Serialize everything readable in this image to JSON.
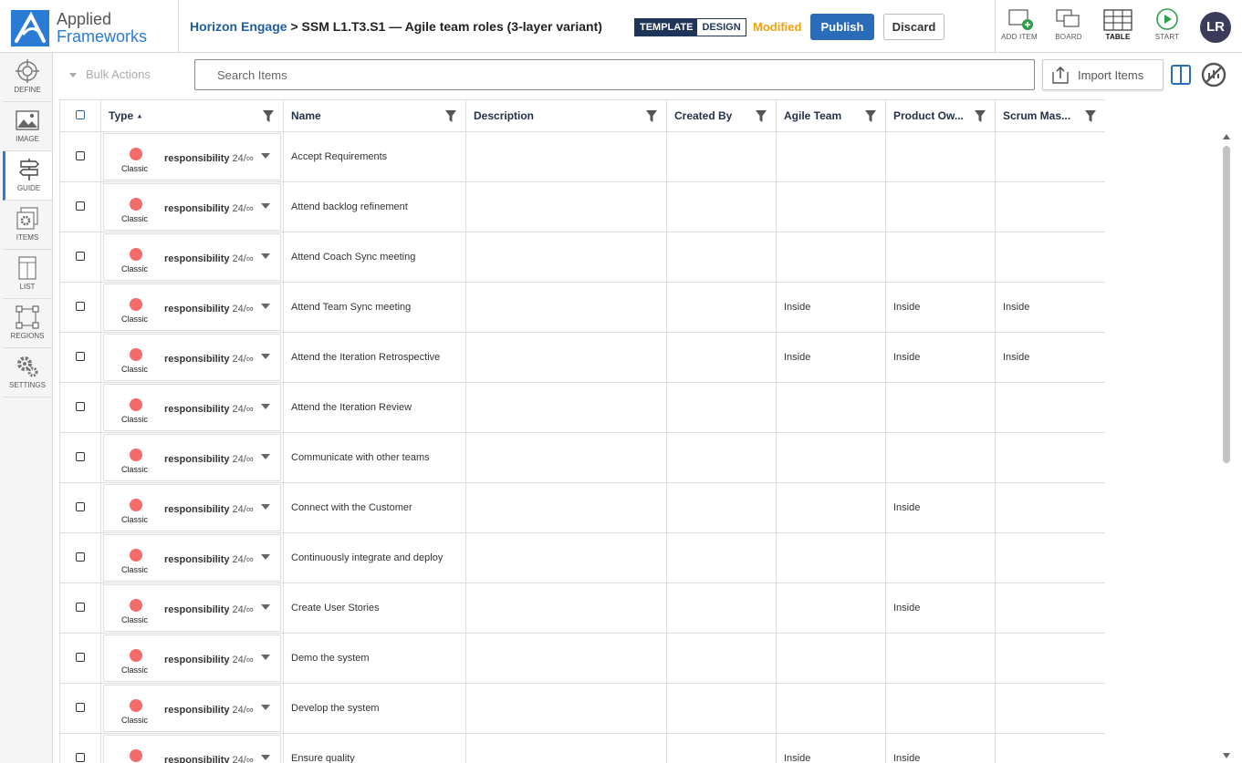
{
  "header": {
    "logo": {
      "line1": "Applied",
      "line2": "Frameworks"
    },
    "breadcrumb": {
      "project": "Horizon Engage",
      "separator": " > ",
      "page": "SSM L1.T3.S1 — Agile team roles (3-layer variant)"
    },
    "mode": {
      "template": "TEMPLATE",
      "design": "DESIGN"
    },
    "status": "Modified",
    "publish_label": "Publish",
    "discard_label": "Discard",
    "tools": {
      "add_item": "ADD ITEM",
      "board": "BOARD",
      "table": "TABLE",
      "start": "START"
    },
    "avatar_initials": "LR"
  },
  "sidebar": {
    "items": [
      {
        "label": "DEFINE",
        "icon": "target-icon"
      },
      {
        "label": "IMAGE",
        "icon": "image-icon"
      },
      {
        "label": "GUIDE",
        "icon": "signpost-icon"
      },
      {
        "label": "ITEMS",
        "icon": "stacked-gear-icon"
      },
      {
        "label": "LIST",
        "icon": "list-icon"
      },
      {
        "label": "REGIONS",
        "icon": "regions-icon"
      },
      {
        "label": "SETTINGS",
        "icon": "settings-icon"
      }
    ],
    "active": "GUIDE"
  },
  "toolbar": {
    "bulk_actions": "Bulk Actions",
    "search_placeholder": "Search Items",
    "import_label": "Import Items"
  },
  "table": {
    "headers": {
      "type": "Type",
      "name": "Name",
      "description": "Description",
      "created_by": "Created By",
      "agile_team": "Agile Team",
      "product_owner": "Product Ow...",
      "scrum_master": "Scrum Mas..."
    },
    "sort_indicator": "▲",
    "type_cell": {
      "style": "Classic",
      "name": "responsibility",
      "count": "24/∞",
      "dot_color": "#f36b6b"
    },
    "rows": [
      {
        "name": "Accept Requirements",
        "description": "",
        "created_by": "",
        "agile_team": "",
        "product_owner": "",
        "scrum_master": ""
      },
      {
        "name": "Attend backlog refinement",
        "description": "",
        "created_by": "",
        "agile_team": "",
        "product_owner": "",
        "scrum_master": ""
      },
      {
        "name": "Attend Coach Sync meeting",
        "description": "",
        "created_by": "",
        "agile_team": "",
        "product_owner": "",
        "scrum_master": ""
      },
      {
        "name": "Attend Team Sync meeting",
        "description": "",
        "created_by": "",
        "agile_team": "Inside",
        "product_owner": "Inside",
        "scrum_master": "Inside"
      },
      {
        "name": "Attend the Iteration Retrospective",
        "description": "",
        "created_by": "",
        "agile_team": "Inside",
        "product_owner": "Inside",
        "scrum_master": "Inside"
      },
      {
        "name": "Attend the Iteration Review",
        "description": "",
        "created_by": "",
        "agile_team": "",
        "product_owner": "",
        "scrum_master": ""
      },
      {
        "name": "Communicate with other teams",
        "description": "",
        "created_by": "",
        "agile_team": "",
        "product_owner": "",
        "scrum_master": ""
      },
      {
        "name": "Connect with the Customer",
        "description": "",
        "created_by": "",
        "agile_team": "",
        "product_owner": "Inside",
        "scrum_master": ""
      },
      {
        "name": "Continuously integrate and deploy",
        "description": "",
        "created_by": "",
        "agile_team": "",
        "product_owner": "",
        "scrum_master": ""
      },
      {
        "name": "Create User Stories",
        "description": "",
        "created_by": "",
        "agile_team": "",
        "product_owner": "Inside",
        "scrum_master": ""
      },
      {
        "name": "Demo the system",
        "description": "",
        "created_by": "",
        "agile_team": "",
        "product_owner": "",
        "scrum_master": ""
      },
      {
        "name": "Develop the system",
        "description": "",
        "created_by": "",
        "agile_team": "",
        "product_owner": "",
        "scrum_master": ""
      },
      {
        "name": "Ensure quality",
        "description": "",
        "created_by": "",
        "agile_team": "Inside",
        "product_owner": "Inside",
        "scrum_master": ""
      }
    ]
  },
  "colors": {
    "brand_blue": "#2a7bd5",
    "publish_button": "#2a6cb8",
    "modified_orange": "#f0a30a",
    "header_navy": "#1f3558"
  }
}
